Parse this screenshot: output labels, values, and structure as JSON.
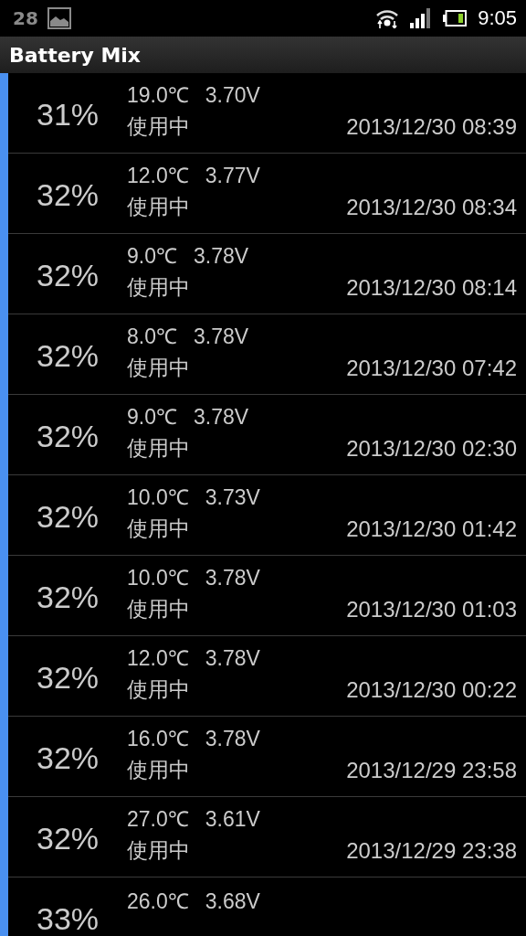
{
  "status_bar": {
    "notification_count": "28",
    "time": "9:05"
  },
  "app_bar": {
    "title": "Battery Mix"
  },
  "records": [
    {
      "percent": "31%",
      "temperature": "19.0℃",
      "voltage": "3.70V",
      "status": "使用中",
      "timestamp": "2013/12/30 08:39"
    },
    {
      "percent": "32%",
      "temperature": "12.0℃",
      "voltage": "3.77V",
      "status": "使用中",
      "timestamp": "2013/12/30 08:34"
    },
    {
      "percent": "32%",
      "temperature": "9.0℃",
      "voltage": "3.78V",
      "status": "使用中",
      "timestamp": "2013/12/30 08:14"
    },
    {
      "percent": "32%",
      "temperature": "8.0℃",
      "voltage": "3.78V",
      "status": "使用中",
      "timestamp": "2013/12/30 07:42"
    },
    {
      "percent": "32%",
      "temperature": "9.0℃",
      "voltage": "3.78V",
      "status": "使用中",
      "timestamp": "2013/12/30 02:30"
    },
    {
      "percent": "32%",
      "temperature": "10.0℃",
      "voltage": "3.73V",
      "status": "使用中",
      "timestamp": "2013/12/30 01:42"
    },
    {
      "percent": "32%",
      "temperature": "10.0℃",
      "voltage": "3.78V",
      "status": "使用中",
      "timestamp": "2013/12/30 01:03"
    },
    {
      "percent": "32%",
      "temperature": "12.0℃",
      "voltage": "3.78V",
      "status": "使用中",
      "timestamp": "2013/12/30 00:22"
    },
    {
      "percent": "32%",
      "temperature": "16.0℃",
      "voltage": "3.78V",
      "status": "使用中",
      "timestamp": "2013/12/29 23:58"
    },
    {
      "percent": "32%",
      "temperature": "27.0℃",
      "voltage": "3.61V",
      "status": "使用中",
      "timestamp": "2013/12/29 23:38"
    },
    {
      "percent": "33%",
      "temperature": "26.0℃",
      "voltage": "3.68V"
    }
  ]
}
